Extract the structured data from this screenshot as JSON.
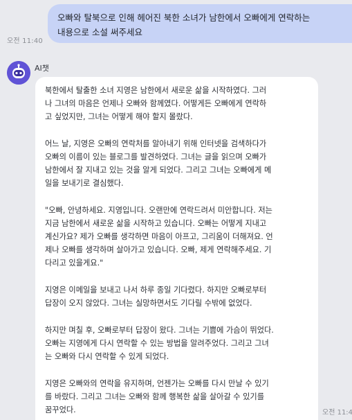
{
  "user_message": {
    "text": "오빠와 탈북으로 인해 헤어진 북한 소녀가 남한에서 오빠에게 연락하는\n내용으로 소설 써주세요",
    "time": "오전 11:40"
  },
  "bot_message": {
    "sender_name": "AI챗",
    "time": "오전 11:4",
    "paragraphs": [
      "북한에서 탈출한 소녀 지영은 남한에서 새로운 삶을 시작하였다. 그러\n나 그녀의 마음은 언제나 오빠와 함께였다. 어떻게든 오빠에게 연락하\n고 싶었지만, 그녀는 어떻게 해야 할지 몰랐다.",
      "어느 날, 지영은 오빠의 연락처를 알아내기 위해 인터넷을 검색하다가\n오빠의 이름이 있는 블로그를 발견하였다. 그녀는 글을 읽으며 오빠가\n남한에서 잘 지내고 있는 것을 알게 되었다. 그리고 그녀는 오빠에게 메\n일을 보내기로 결심했다.",
      "\"오빠, 안녕하세요. 지영입니다. 오랜만에 연락드려서 미안합니다. 저는\n지금 남한에서 새로운 삶을 시작하고 있습니다. 오빠는 어떻게 지내고\n계신가요? 제가 오빠를 생각하면 마음이 아프고, 그리움이 더해져요. 언\n제나 오빠를 생각하며 살아가고 있습니다. 오빠, 제게 연락해주세요. 기\n다리고 있을게요.\"",
      "지영은 이메일을 보내고 나서 하루 종일 기다렸다. 하지만 오빠로부터\n답장이 오지 않았다. 그녀는 실망하면서도 기다릴 수밖에 없었다.",
      "하지만 며칠 후, 오빠로부터 답장이 왔다. 그녀는 기쁨에 가슴이 뛰었다.\n 오빠는 지영에게 다시 연락할 수 있는 방법을 알려주었다. 그리고 그녀\n는 오빠와 다시 연락할 수 있게 되었다.",
      "지영은 오빠와의 연락을 유지하며, 언젠가는 오빠를 다시 만날 수 있기\n를 바랐다. 그리고 그녀는 오빠와 함께 행복한 삶을 살아갈 수 있기를\n꿈꾸었다."
    ]
  },
  "avatar_icon": "robot-face-icon",
  "colors": {
    "background": "#e9eaee",
    "user_bubble": "#c7d3f6",
    "bot_bubble": "#ffffff",
    "avatar": "#6053d6"
  }
}
